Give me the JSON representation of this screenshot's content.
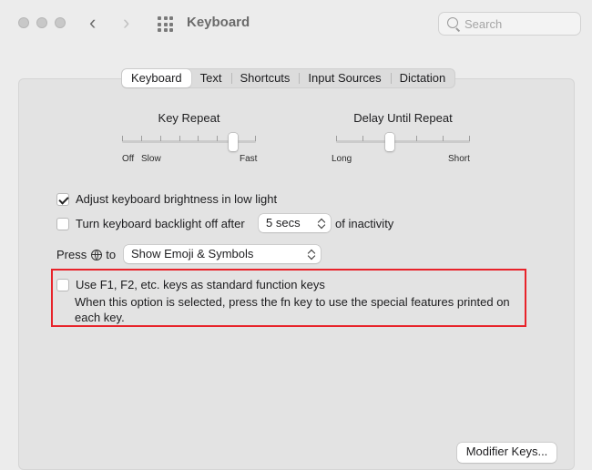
{
  "window": {
    "title": "Keyboard",
    "back_icon": "chevron-left-icon",
    "forward_icon": "chevron-right-icon",
    "grid_icon": "show-all-grid-icon"
  },
  "search": {
    "placeholder": "Search",
    "value": ""
  },
  "tabs": [
    {
      "label": "Keyboard",
      "active": true
    },
    {
      "label": "Text",
      "active": false
    },
    {
      "label": "Shortcuts",
      "active": false
    },
    {
      "label": "Input Sources",
      "active": false
    },
    {
      "label": "Dictation",
      "active": false
    }
  ],
  "key_repeat": {
    "title": "Key Repeat",
    "label_off": "Off",
    "label_slow": "Slow",
    "label_fast": "Fast",
    "ticks": 8,
    "position_fraction": 0.83
  },
  "delay_until_repeat": {
    "title": "Delay Until Repeat",
    "label_long": "Long",
    "label_short": "Short",
    "ticks": 6,
    "position_fraction": 0.4
  },
  "options": {
    "brightness": {
      "label": "Adjust keyboard brightness in low light",
      "checked": true
    },
    "backlight": {
      "label_before": "Turn keyboard backlight off after",
      "value": "5 secs",
      "label_after": "of inactivity",
      "checked": false
    },
    "press_globe": {
      "label_press": "Press",
      "label_to": "to",
      "value": "Show Emoji & Symbols",
      "icon": "globe-icon"
    },
    "function_keys": {
      "label": "Use F1, F2, etc. keys as standard function keys",
      "description": "When this option is selected, press the fn key to use the special features printed on each key.",
      "checked": false
    }
  },
  "buttons": {
    "modifier_keys": "Modifier Keys..."
  },
  "colors": {
    "highlight": "#e8232a",
    "background": "#ececec"
  }
}
